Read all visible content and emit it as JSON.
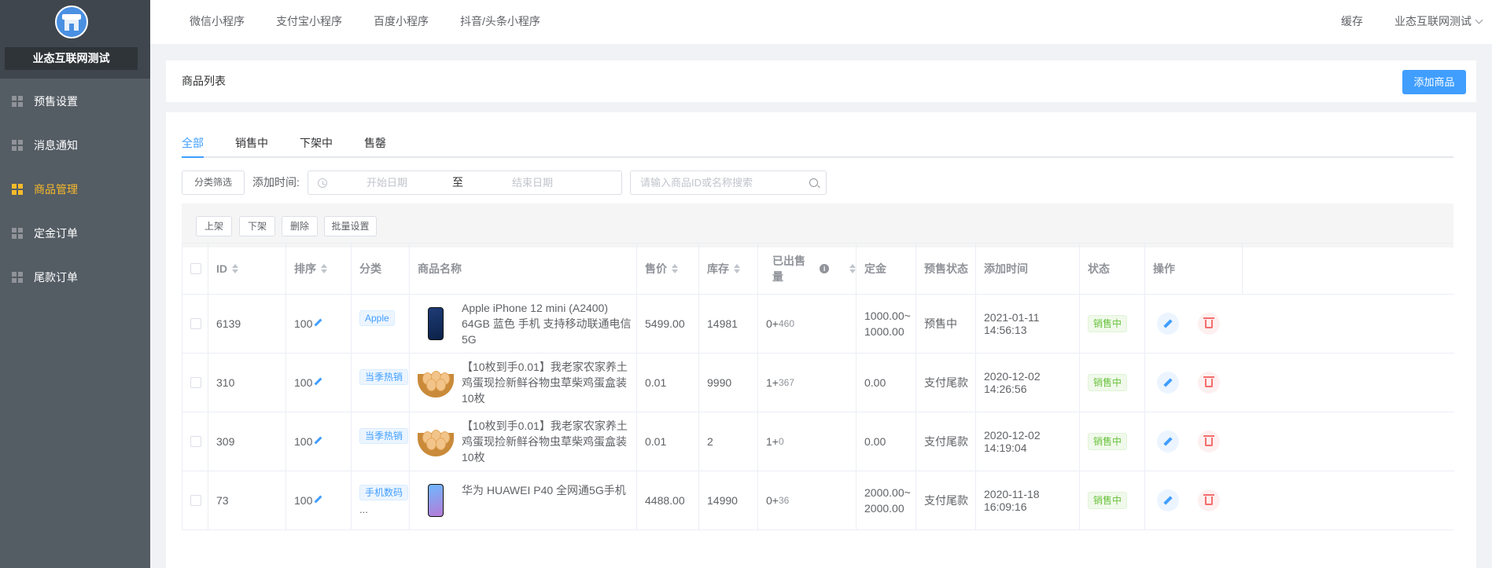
{
  "brand": {
    "name": "业态互联网测试"
  },
  "sidebar": {
    "items": [
      {
        "label": "预售设置"
      },
      {
        "label": "消息通知"
      },
      {
        "label": "商品管理"
      },
      {
        "label": "定金订单"
      },
      {
        "label": "尾款订单"
      }
    ],
    "active_item": "商品管理",
    "active_color": "#f7ba2a"
  },
  "topbar": {
    "nav": [
      {
        "label": "微信小程序"
      },
      {
        "label": "支付宝小程序"
      },
      {
        "label": "百度小程序"
      },
      {
        "label": "抖音/头条小程序"
      }
    ],
    "cache_label": "缓存",
    "user_label": "业态互联网测试"
  },
  "header": {
    "title": "商品列表",
    "add_button": "添加商品"
  },
  "tabs": [
    {
      "label": "全部"
    },
    {
      "label": "销售中"
    },
    {
      "label": "下架中"
    },
    {
      "label": "售罄"
    }
  ],
  "active_tab": "全部",
  "filter": {
    "category_button": "分类筛选",
    "time_label": "添加时间:",
    "start_placeholder": "开始日期",
    "range_separator": "至",
    "end_placeholder": "结束日期",
    "search_placeholder": "请输入商品ID或名称搜索"
  },
  "actions": [
    {
      "label": "上架"
    },
    {
      "label": "下架"
    },
    {
      "label": "删除"
    },
    {
      "label": "批量设置"
    }
  ],
  "table": {
    "columns": {
      "id": "ID",
      "sort": "排序",
      "category": "分类",
      "name": "商品名称",
      "price": "售价",
      "stock": "库存",
      "sold": "已出售量",
      "deposit": "定金",
      "presale_status": "预售状态",
      "added_time": "添加时间",
      "status": "状态",
      "ops": "操作"
    },
    "rows": [
      {
        "id": "6139",
        "sort": "100",
        "category": "Apple",
        "name": "Apple iPhone 12 mini (A2400) 64GB 蓝色 手机 支持移动联通电信5G",
        "image": "iphone-image",
        "price": "5499.00",
        "stock": "14981",
        "sold_main": "0+",
        "sold_extra": "460",
        "deposit": "1000.00~1000.00",
        "presale_status": "预售中",
        "added_time": "2021-01-11 14:56:13",
        "status": "销售中"
      },
      {
        "id": "310",
        "sort": "100",
        "category": "当季热销",
        "name": "【10枚到手0.01】我老家农家养土鸡蛋现捡新鲜谷物虫草柴鸡蛋盒装10枚",
        "image": "eggs-image",
        "price": "0.01",
        "stock": "9990",
        "sold_main": "1+",
        "sold_extra": "367",
        "deposit": "0.00",
        "presale_status": "支付尾款",
        "added_time": "2020-12-02 14:26:56",
        "status": "销售中"
      },
      {
        "id": "309",
        "sort": "100",
        "category": "当季热销",
        "name": "【10枚到手0.01】我老家农家养土鸡蛋现捡新鲜谷物虫草柴鸡蛋盒装10枚",
        "image": "eggs-image",
        "price": "0.01",
        "stock": "2",
        "sold_main": "1+",
        "sold_extra": "0",
        "deposit": "0.00",
        "presale_status": "支付尾款",
        "added_time": "2020-12-02 14:19:04",
        "status": "销售中"
      },
      {
        "id": "73",
        "sort": "100",
        "category": "手机数码",
        "category_more": "...",
        "name": "华为 HUAWEI P40 全网通5G手机",
        "image": "huawei-image",
        "price": "4488.00",
        "stock": "14990",
        "sold_main": "0+",
        "sold_extra": "36",
        "deposit": "2000.00~2000.00",
        "presale_status": "支付尾款",
        "added_time": "2020-11-18 16:09:16",
        "status": "销售中"
      }
    ]
  },
  "colors": {
    "primary": "#409eff",
    "sidebar_bg": "#545c64",
    "success": "#67c23a",
    "danger": "#f56c6c"
  }
}
